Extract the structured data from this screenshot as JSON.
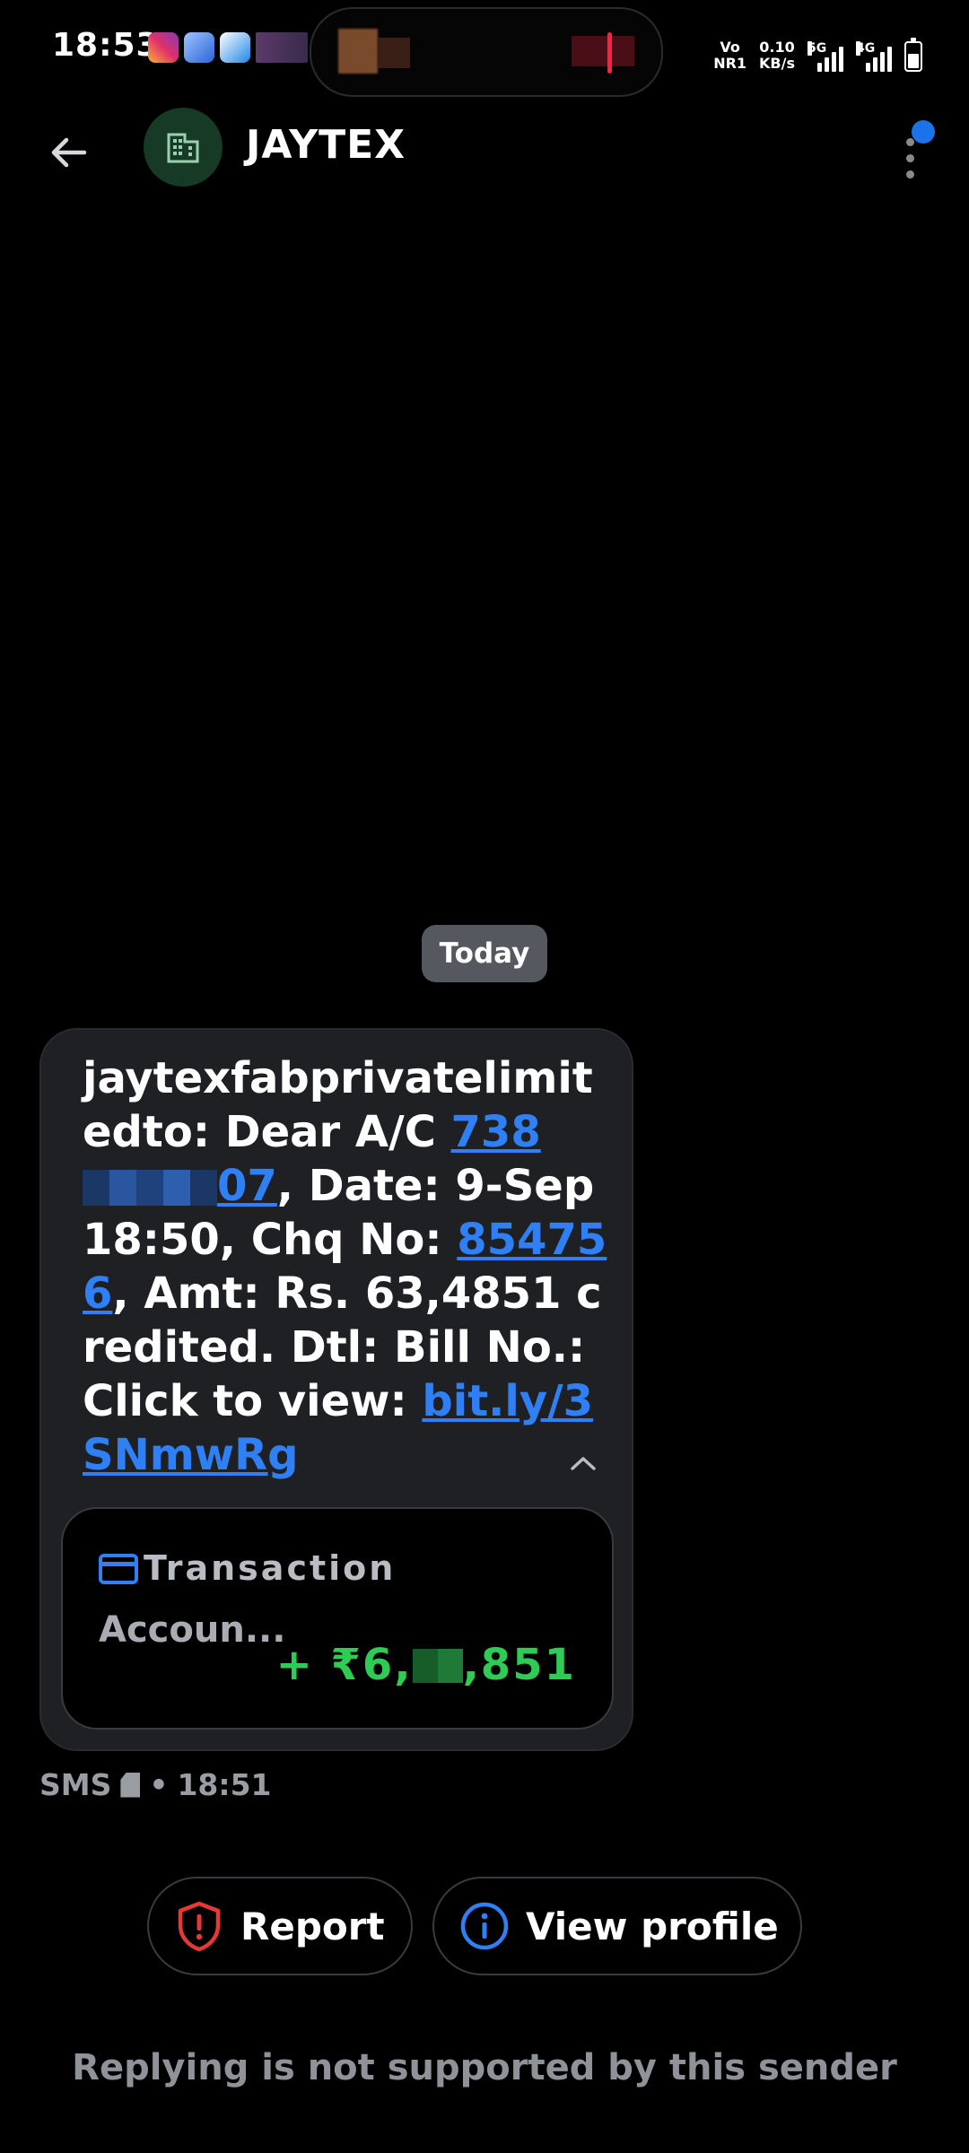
{
  "status_bar": {
    "time": "18:53",
    "volte": "Vo",
    "volte_sub": "NR1",
    "speed": "0.10",
    "speed_unit": "KB/s",
    "net1": "5G",
    "net2": "4G"
  },
  "header": {
    "title": "JAYTEX",
    "avatar_icon": "building-icon",
    "back_icon": "arrow-left-icon",
    "more_icon": "more-vert-icon"
  },
  "conversation": {
    "date_chip": "Today",
    "message": {
      "part1": "jaytexfabprivatelimitedto: Dear A/C ",
      "account_prefix": "738",
      "account_suffix": "07",
      "part2": ", Date: 9-Sep 18:50, Chq No: ",
      "cheque_no": "854756",
      "part3": ", Amt: Rs. 63,4851 credited. Dtl: Bill No.: Click to view: ",
      "link": "bit.ly/3SNmwRg"
    },
    "transaction_card": {
      "title": "Transaction",
      "subtitle": "Accoun...",
      "amount_prefix": "+ ₹6,",
      "amount_suffix": ",851",
      "icon": "credit-card-icon",
      "amount_color": "#2ecc55"
    },
    "meta": {
      "channel": "SMS",
      "time": "18:51",
      "separator": "•"
    }
  },
  "actions": {
    "report_label": "Report",
    "report_icon": "shield-alert-icon",
    "report_color": "#e53935",
    "profile_label": "View profile",
    "profile_icon": "info-icon",
    "profile_color": "#2f80f5"
  },
  "footer": {
    "note": "Replying is not supported by this sender"
  }
}
